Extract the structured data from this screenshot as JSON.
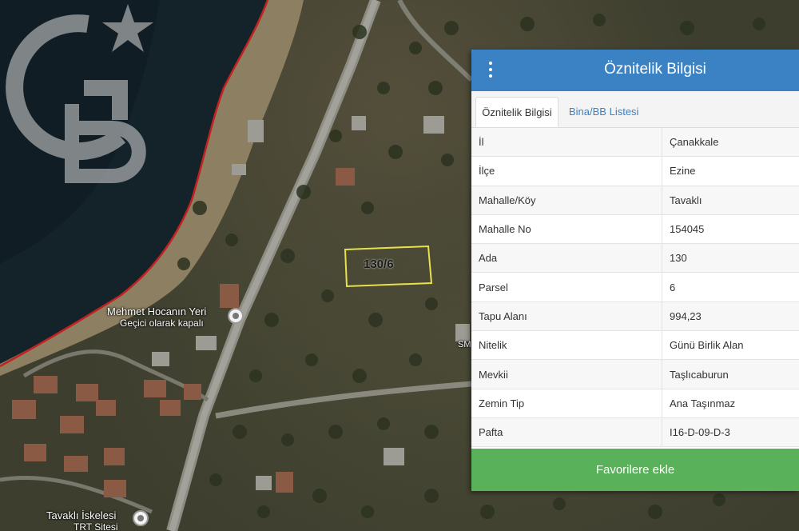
{
  "map": {
    "labels": [
      {
        "id": "place-mehmet",
        "text": "Mehmet Hocanın Yeri"
      },
      {
        "id": "place-mehmet-sub",
        "text": "Geçici olarak kapalı"
      },
      {
        "id": "place-tavakli",
        "text": "Tavaklı İskelesi"
      },
      {
        "id": "place-tavakli-sub",
        "text": "TRT Sitesi"
      }
    ],
    "parcel_label": "130/6",
    "small_label": "SM",
    "watermark_letters": "GB"
  },
  "panel": {
    "title": "Öznitelik Bilgisi",
    "tabs": [
      {
        "label": "Öznitelik Bilgisi",
        "active": true
      },
      {
        "label": "Bina/BB Listesi",
        "active": false
      }
    ],
    "rows": [
      {
        "key": "İl",
        "value": "Çanakkale"
      },
      {
        "key": "İlçe",
        "value": "Ezine"
      },
      {
        "key": "Mahalle/Köy",
        "value": "Tavaklı"
      },
      {
        "key": "Mahalle No",
        "value": "154045"
      },
      {
        "key": "Ada",
        "value": "130"
      },
      {
        "key": "Parsel",
        "value": "6"
      },
      {
        "key": "Tapu Alanı",
        "value": "994,23"
      },
      {
        "key": "Nitelik",
        "value": "Günü Birlik Alan"
      },
      {
        "key": "Mevkii",
        "value": "Taşlıcaburun"
      },
      {
        "key": "Zemin Tip",
        "value": "Ana Taşınmaz"
      },
      {
        "key": "Pafta",
        "value": "I16-D-09-D-3"
      }
    ],
    "favorite_button": "Favorilere ekle",
    "colors": {
      "header": "#3a82c4",
      "button": "#59b15a",
      "tab_link": "#3a82c4"
    }
  }
}
